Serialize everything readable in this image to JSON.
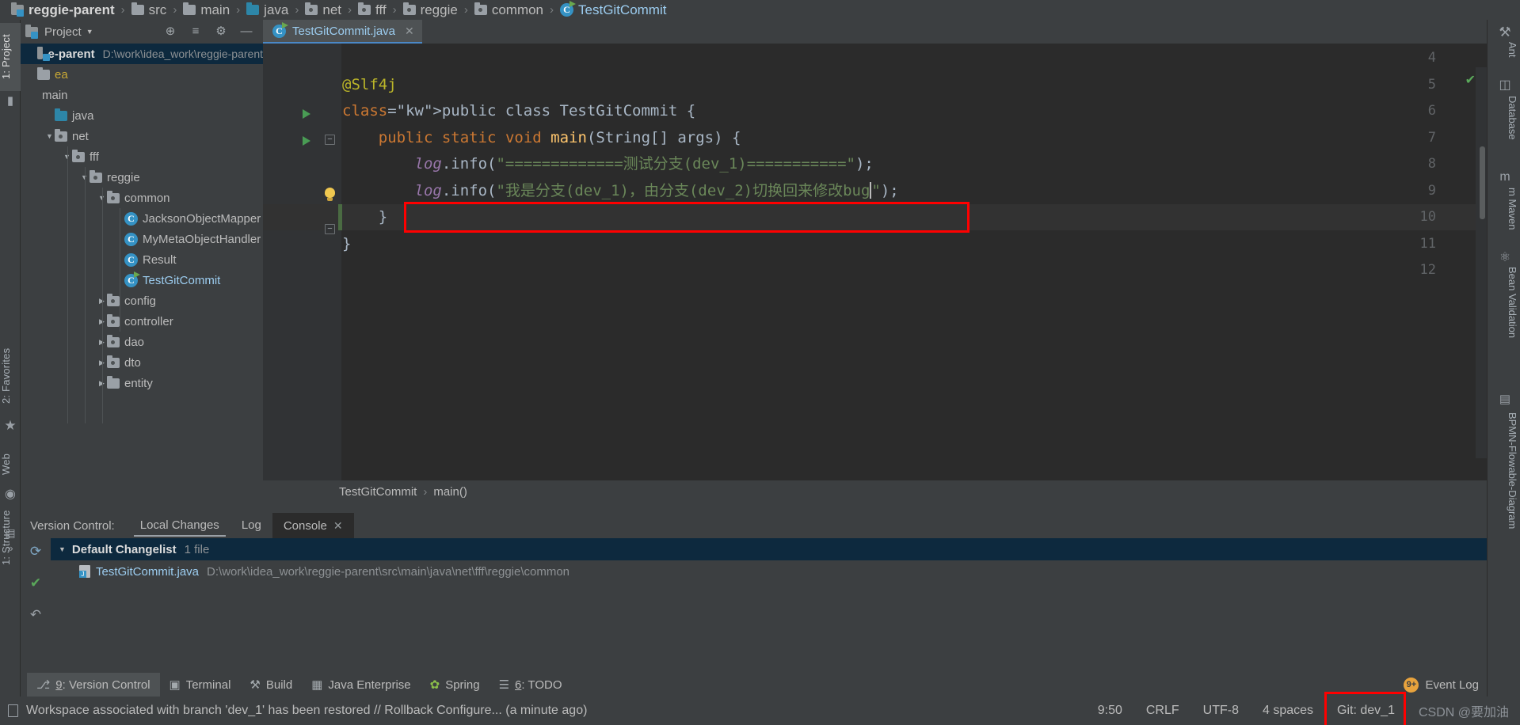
{
  "breadcrumb": {
    "items": [
      {
        "label": "reggie-parent",
        "icon": "project-folder-icon",
        "bold": true
      },
      {
        "label": "src",
        "icon": "folder-icon",
        "bold": false
      },
      {
        "label": "main",
        "icon": "folder-icon",
        "bold": false
      },
      {
        "label": "java",
        "icon": "source-folder-icon",
        "bold": false
      },
      {
        "label": "net",
        "icon": "package-icon",
        "bold": false
      },
      {
        "label": "fff",
        "icon": "package-icon",
        "bold": false
      },
      {
        "label": "reggie",
        "icon": "package-icon",
        "bold": false
      },
      {
        "label": "common",
        "icon": "package-icon",
        "bold": false
      },
      {
        "label": "TestGitCommit",
        "icon": "java-class-runnable-icon",
        "bold": false
      }
    ],
    "separator": "›"
  },
  "left_strip": {
    "tabs": [
      {
        "label": "1: Project",
        "selected": true
      },
      {
        "label": "2: Favorites",
        "selected": false
      },
      {
        "label": "Web",
        "selected": false
      },
      {
        "label": "1: Structure",
        "selected": false
      }
    ],
    "more_label": "»"
  },
  "project_panel": {
    "title": "Project",
    "caret": "▼",
    "actions": [
      {
        "name": "locate-icon",
        "glyph": "⊕"
      },
      {
        "name": "collapse-all-icon",
        "glyph": "≡"
      },
      {
        "name": "settings-gear-icon",
        "glyph": "⚙"
      },
      {
        "name": "hide-panel-icon",
        "glyph": "—"
      }
    ],
    "tree": [
      {
        "depth": 0,
        "arrow": "",
        "icon": "project-folder-icon",
        "label": "e-parent",
        "path": "D:\\work\\idea_work\\reggie-parent",
        "selected": true,
        "bold": true,
        "blue": false
      },
      {
        "depth": 0,
        "arrow": "",
        "icon": "folder-icon",
        "label": "ea",
        "path": "",
        "selected": false,
        "bold": false,
        "blue": false,
        "yellowish": true
      },
      {
        "depth": 0,
        "arrow": "",
        "icon": "",
        "label": "main",
        "path": "",
        "selected": false,
        "bold": false,
        "blue": false
      },
      {
        "depth": 1,
        "arrow": "",
        "icon": "source-folder-icon",
        "label": "java",
        "path": "",
        "selected": false,
        "bold": false,
        "blue": false
      },
      {
        "depth": 1,
        "arrow": "▼",
        "icon": "package-icon",
        "label": "net",
        "path": "",
        "selected": false,
        "bold": false,
        "blue": false
      },
      {
        "depth": 2,
        "arrow": "▼",
        "icon": "package-icon",
        "label": "fff",
        "path": "",
        "selected": false,
        "bold": false,
        "blue": false
      },
      {
        "depth": 3,
        "arrow": "▼",
        "icon": "package-icon",
        "label": "reggie",
        "path": "",
        "selected": false,
        "bold": false,
        "blue": false
      },
      {
        "depth": 4,
        "arrow": "▼",
        "icon": "package-icon",
        "label": "common",
        "path": "",
        "selected": false,
        "bold": false,
        "blue": false
      },
      {
        "depth": 5,
        "arrow": "",
        "icon": "java-class-icon",
        "label": "JacksonObjectMapper",
        "path": "",
        "selected": false,
        "bold": false,
        "blue": false
      },
      {
        "depth": 5,
        "arrow": "",
        "icon": "java-class-icon",
        "label": "MyMetaObjectHandler",
        "path": "",
        "selected": false,
        "bold": false,
        "blue": false
      },
      {
        "depth": 5,
        "arrow": "",
        "icon": "java-class-icon",
        "label": "Result",
        "path": "",
        "selected": false,
        "bold": false,
        "blue": false
      },
      {
        "depth": 5,
        "arrow": "",
        "icon": "java-class-runnable-icon",
        "label": "TestGitCommit",
        "path": "",
        "selected": false,
        "bold": false,
        "blue": true
      },
      {
        "depth": 4,
        "arrow": "▶",
        "icon": "package-icon",
        "label": "config",
        "path": "",
        "selected": false,
        "bold": false,
        "blue": false
      },
      {
        "depth": 4,
        "arrow": "▶",
        "icon": "package-icon",
        "label": "controller",
        "path": "",
        "selected": false,
        "bold": false,
        "blue": false
      },
      {
        "depth": 4,
        "arrow": "▶",
        "icon": "package-icon",
        "label": "dao",
        "path": "",
        "selected": false,
        "bold": false,
        "blue": false
      },
      {
        "depth": 4,
        "arrow": "▶",
        "icon": "package-icon",
        "label": "dto",
        "path": "",
        "selected": false,
        "bold": false,
        "blue": false
      },
      {
        "depth": 4,
        "arrow": "▶",
        "icon": "folder-icon",
        "label": "entity",
        "path": "",
        "selected": false,
        "bold": false,
        "blue": false
      }
    ]
  },
  "editor": {
    "tab": {
      "label": "TestGitCommit.java",
      "close": "✕",
      "icon": "java-class-runnable-icon"
    },
    "first_visible_line": 4,
    "lines": [
      {
        "no": 4,
        "text": "",
        "gutter": ""
      },
      {
        "no": 5,
        "text": "@Slf4j",
        "gutter": ""
      },
      {
        "no": 6,
        "text": "public class TestGitCommit {",
        "gutter": "run"
      },
      {
        "no": 7,
        "text": "    public static void main(String[] args) {",
        "gutter": "run-fold"
      },
      {
        "no": 8,
        "text": "        log.info(\"=============测试分支(dev_1)===========\");",
        "gutter": ""
      },
      {
        "no": 9,
        "text": "        log.info(\"我是分支(dev_1)，由分支(dev_2)切换回来修改bug\");",
        "gutter": "bulb"
      },
      {
        "no": 10,
        "text": "    }",
        "gutter": "fold-end"
      },
      {
        "no": 11,
        "text": "}",
        "gutter": ""
      },
      {
        "no": 12,
        "text": "",
        "gutter": ""
      }
    ],
    "string_line8": "\"=============测试分支(dev_1)===========\"",
    "string_line9": "\"我是分支(dev_1)，由分支(dev_2)切换回来修改bug\"",
    "breadcrumb_bottom": [
      "TestGitCommit",
      "main()"
    ],
    "breadcrumb_sep": "›",
    "inspection_ok": "✔"
  },
  "right_strip": {
    "tabs": [
      "Ant",
      "Database",
      "m Maven",
      "Bean Validation",
      "BPMN-Flowable-Diagram"
    ],
    "icons": [
      "hammer-icon",
      "database-icon",
      "maven-icon",
      "bean-icon",
      "bpmn-icon",
      "structure-icon"
    ]
  },
  "version_control": {
    "label": "Version Control:",
    "tabs": [
      {
        "label": "Local Changes",
        "selected": true,
        "closable": false
      },
      {
        "label": "Log",
        "selected": false,
        "closable": false
      },
      {
        "label": "Console",
        "selected": false,
        "closable": true,
        "close": "✕"
      }
    ],
    "side_actions": [
      {
        "name": "refresh-icon",
        "glyph": "⟳"
      },
      {
        "name": "commit-check-icon",
        "glyph": "✔"
      },
      {
        "name": "rollback-icon",
        "glyph": "↶"
      }
    ],
    "panel_actions": [
      {
        "name": "settings-gear-icon",
        "glyph": "⚙"
      },
      {
        "name": "hide-panel-icon",
        "glyph": "—"
      }
    ],
    "changelist": {
      "caret": "▼",
      "name": "Default Changelist",
      "count": "1 file"
    },
    "files": [
      {
        "name": "TestGitCommit.java",
        "path": "D:\\work\\idea_work\\reggie-parent\\src\\main\\java\\net\\fff\\reggie\\common"
      }
    ]
  },
  "tool_windows": [
    {
      "label": "9: Version Control",
      "underline": "9",
      "icon": "vcs-branch-icon",
      "selected": true
    },
    {
      "label": "Terminal",
      "icon": "terminal-icon",
      "selected": false
    },
    {
      "label": "Build",
      "icon": "hammer-icon",
      "selected": false
    },
    {
      "label": "Java Enterprise",
      "icon": "java-ee-icon",
      "selected": false
    },
    {
      "label": "Spring",
      "icon": "spring-leaf-icon",
      "selected": false
    },
    {
      "label": "6: TODO",
      "underline": "6",
      "icon": "todo-list-icon",
      "selected": false
    }
  ],
  "event_log": {
    "label": "Event Log",
    "badge": "9+"
  },
  "status_bar": {
    "message": "Workspace associated with branch 'dev_1' has been restored // Rollback   Configure... (a minute ago)",
    "caret_position": "9:50",
    "line_separator": "CRLF",
    "encoding": "UTF-8",
    "indent": "4 spaces",
    "git_branch": "Git: dev_1",
    "watermark": "CSDN @要加油"
  },
  "colors": {
    "accent_blue": "#3592c4",
    "selection_blue": "#0d293e",
    "editor_bg": "#2b2b2b",
    "panel_bg": "#3c3f41",
    "string_green": "#6a8759",
    "keyword_orange": "#cc7832",
    "annotation_yellow": "#bbb529",
    "method_yellow": "#ffc66d",
    "field_purple": "#9876aa",
    "highlight_red": "#ff0000"
  }
}
